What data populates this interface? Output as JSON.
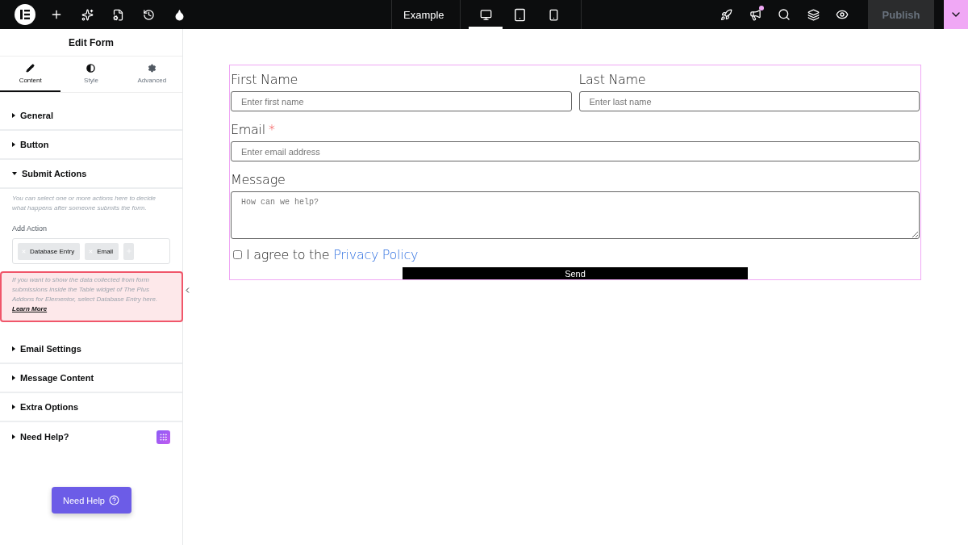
{
  "topbar": {
    "document_title": "Example",
    "devices": [
      {
        "kind": "desktop",
        "selected": true
      },
      {
        "kind": "tablet",
        "selected": false
      },
      {
        "kind": "mobile",
        "selected": false
      }
    ],
    "notification": true,
    "publish": {
      "label": "Publish",
      "disabled": true
    }
  },
  "panel": {
    "title": "Edit Form",
    "tabs": [
      {
        "kind": "content",
        "label": "Content",
        "selected": true
      },
      {
        "kind": "style",
        "label": "Style",
        "selected": false
      },
      {
        "kind": "advanced",
        "label": "Advanced",
        "selected": false
      }
    ],
    "sections": [
      {
        "label": "General",
        "expanded": false
      },
      {
        "label": "Button",
        "expanded": false
      },
      {
        "label": "Submit Actions",
        "expanded": true,
        "description": "You can select one or more actions here to decide what happens after someone submits the form.",
        "add_action_label": "Add Action",
        "actions": [
          "Database Entry",
          "Email"
        ],
        "notice": {
          "text": "If you want to show the data collected from form submissions inside the Table widget of The Plus Addons for Elementor, select Database Entry here.",
          "link": "Learn More"
        }
      },
      {
        "label": "Email Settings",
        "expanded": false
      },
      {
        "label": "Message Content",
        "expanded": false
      },
      {
        "label": "Extra Options",
        "expanded": false
      },
      {
        "label": "Need Help?",
        "expanded": false,
        "addon_badge": true
      }
    ],
    "help_button": "Need Help"
  },
  "form": {
    "rows": [
      [
        {
          "kind": "input",
          "label": "First Name",
          "placeholder": "Enter first name"
        },
        {
          "kind": "input",
          "label": "Last Name",
          "placeholder": "Enter last name"
        }
      ],
      [
        {
          "kind": "input",
          "label": "Email",
          "required_mark": "*",
          "placeholder": "Enter email address"
        }
      ],
      [
        {
          "kind": "textarea",
          "label": "Message",
          "placeholder": "How can we help?"
        }
      ]
    ],
    "consent": {
      "checked": false,
      "text": "I agree to the",
      "link": "Privacy Policy"
    },
    "submit": "Send"
  }
}
